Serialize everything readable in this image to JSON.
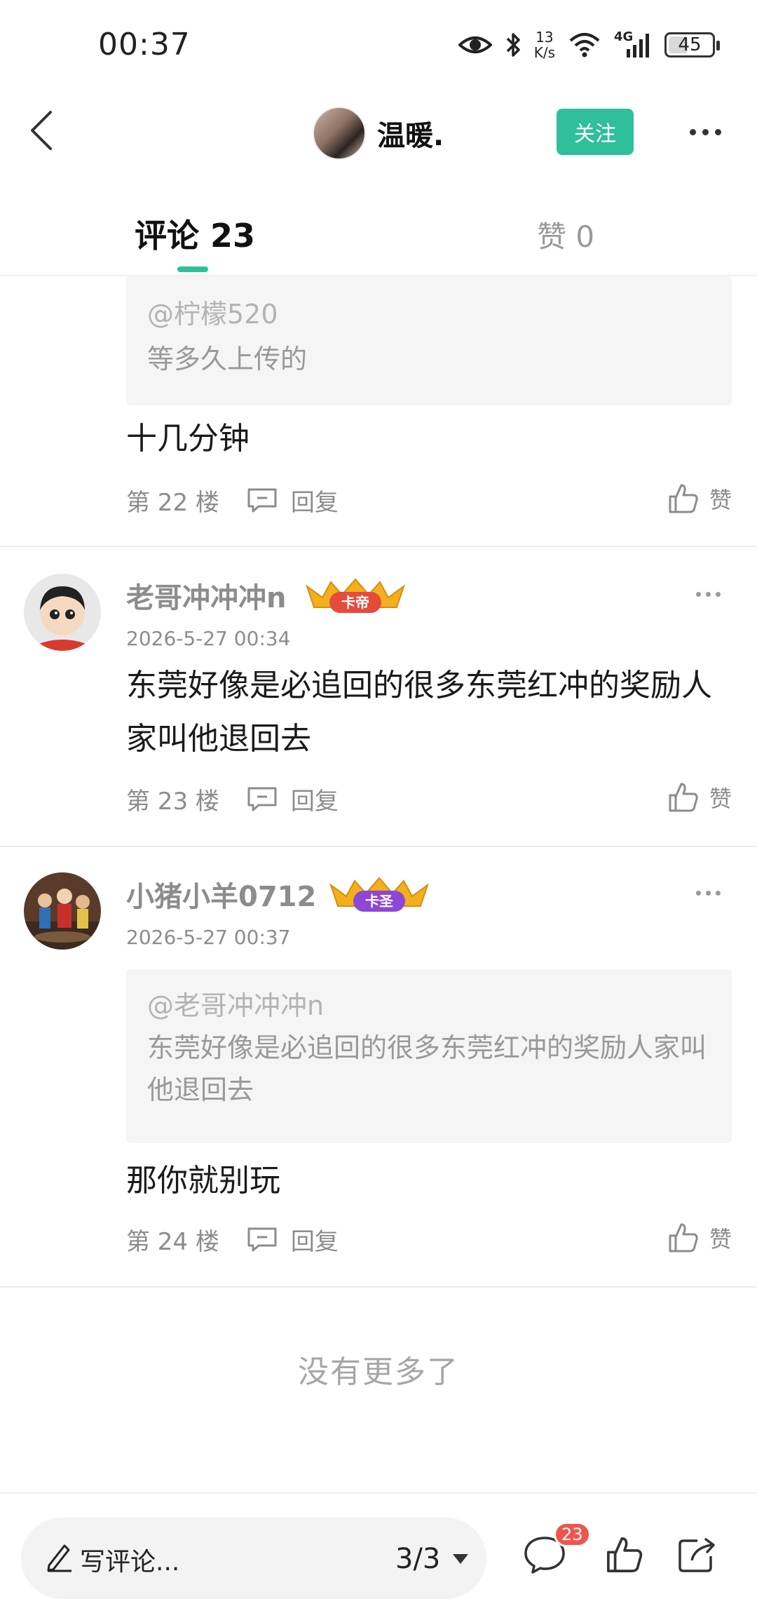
{
  "status_bar": {
    "time": "00:37",
    "net_speed_value": "13",
    "net_speed_unit": "K/s",
    "network": "4G",
    "battery": "45",
    "battery_level": 0.45
  },
  "header": {
    "user_name": "温暖.",
    "follow_label": "关注"
  },
  "tabs": [
    {
      "label": "评论 23",
      "active": true
    },
    {
      "label": "赞 0",
      "active": false
    }
  ],
  "comments": [
    {
      "quote_mention": "@柠檬520",
      "quote_text": "等多久上传的",
      "text": "十几分钟",
      "floor": "第 22 楼",
      "reply_label": "回复",
      "like_label": "赞"
    },
    {
      "user": "老哥冲冲冲n",
      "badge": "卡帝",
      "time": "2026-5-27 00:34",
      "text": "东莞好像是必追回的很多东莞红冲的奖励人家叫他退回去",
      "floor": "第 23 楼",
      "reply_label": "回复",
      "like_label": "赞"
    },
    {
      "user": "小猪小羊0712",
      "badge": "卡圣",
      "time": "2026-5-27 00:37",
      "quote_mention": "@老哥冲冲冲n",
      "quote_text": "东莞好像是必追回的很多东莞红冲的奖励人家叫他退回去",
      "text": "那你就别玩",
      "floor": "第 24 楼",
      "reply_label": "回复",
      "like_label": "赞"
    }
  ],
  "no_more_text": "没有更多了",
  "bottom_bar": {
    "input_placeholder": "写评论...",
    "page_indicator": "3/3",
    "comment_count": "23"
  },
  "colors": {
    "accent": "#2fbf9a",
    "badge_red": "#f0554d",
    "muted_text": "#8c8c8c"
  }
}
